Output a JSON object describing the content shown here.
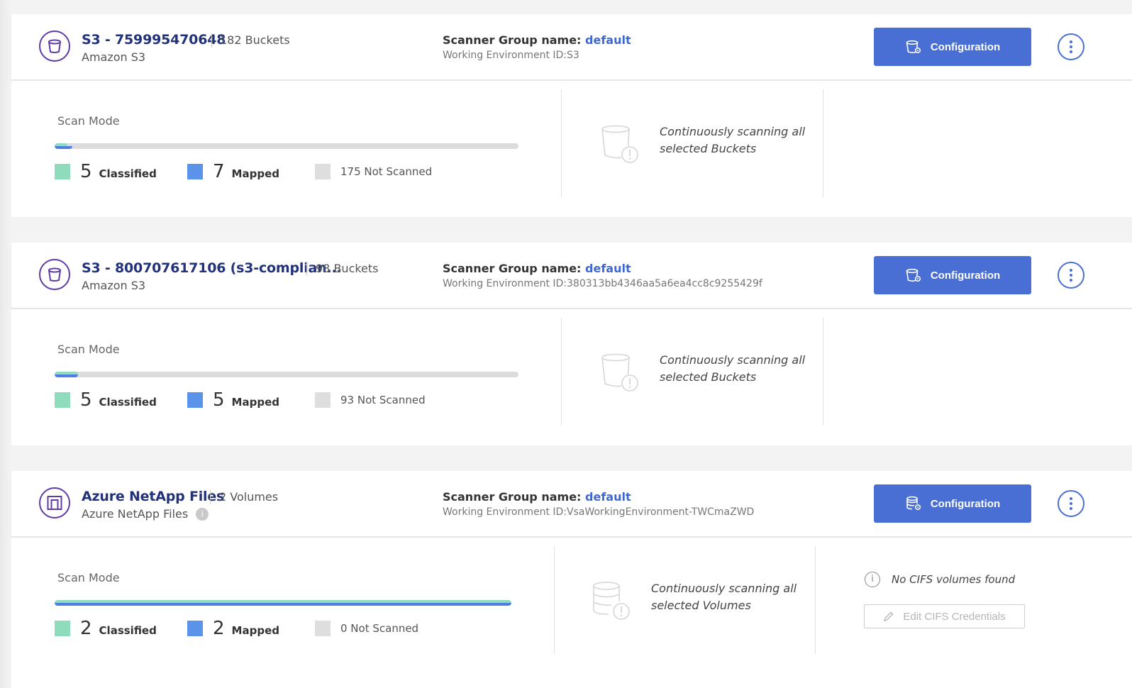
{
  "colors": {
    "accent": "#4a6fd4",
    "title": "#21327a",
    "classified": "#8fdcbd",
    "mapped": "#4f7ee3",
    "not_scanned": "#dcdcdc",
    "icon_ring": "#5e3ba6"
  },
  "environments": [
    {
      "icon": "bucket-icon",
      "title": "S3 - 759995470648",
      "subtitle": "Amazon S3",
      "count_label": "182 Buckets",
      "scanner_group_label": "Scanner Group name:",
      "scanner_group_value": "default",
      "working_env": "Working Environment ID:S3",
      "config_label": "Configuration",
      "scan_mode_label": "Scan Mode",
      "classified_count": "5",
      "classified_label": "Classified",
      "mapped_count": "7",
      "mapped_label": "Mapped",
      "not_scanned_label": "175 Not Scanned",
      "classified_fraction": 0.027,
      "mapped_fraction": 0.038,
      "status_text": "Continuously scanning all selected Buckets"
    },
    {
      "icon": "bucket-icon",
      "title": "S3 - 800707617106 (s3-complian...",
      "subtitle": "Amazon S3",
      "count_label": "98 Buckets",
      "scanner_group_label": "Scanner Group name:",
      "scanner_group_value": "default",
      "working_env": "Working Environment ID:380313bb4346aa5a6ea4cc8c9255429f",
      "config_label": "Configuration",
      "scan_mode_label": "Scan Mode",
      "classified_count": "5",
      "classified_label": "Classified",
      "mapped_count": "5",
      "mapped_label": "Mapped",
      "not_scanned_label": "93 Not Scanned",
      "classified_fraction": 0.051,
      "mapped_fraction": 0.051,
      "status_text": "Continuously scanning all selected Buckets"
    },
    {
      "icon": "azure-netapp-icon",
      "title": "Azure NetApp Files",
      "subtitle": "Azure NetApp Files",
      "count_label": "2 Volumes",
      "scanner_group_label": "Scanner Group name:",
      "scanner_group_value": "default",
      "working_env": "Working Environment ID:VsaWorkingEnvironment-TWCmaZWD",
      "config_label": "Configuration",
      "scan_mode_label": "Scan Mode",
      "classified_count": "2",
      "classified_label": "Classified",
      "mapped_count": "2",
      "mapped_label": "Mapped",
      "not_scanned_label": "0 Not Scanned",
      "classified_fraction": 1.0,
      "mapped_fraction": 1.0,
      "status_text": "Continuously scanning all selected Volumes",
      "cifs_note": "No CIFS volumes found",
      "cifs_button": "Edit CIFS Credentials"
    }
  ]
}
